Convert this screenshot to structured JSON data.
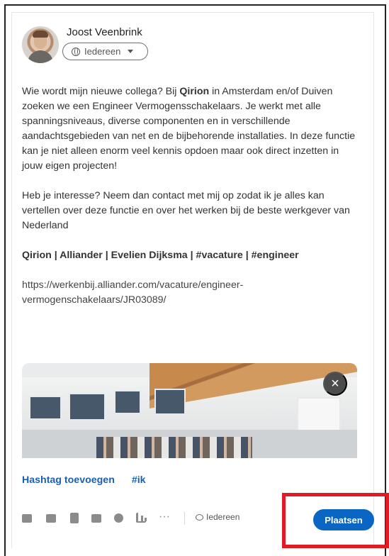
{
  "author": {
    "name": "Joost Veenbrink",
    "visibility_label": "Iedereen"
  },
  "post": {
    "paragraph1_start": "Wie wordt mijn nieuwe collega? Bij ",
    "paragraph1_company": "Qirion",
    "paragraph1_end": " in Amsterdam en/of Duiven zoeken we een Engineer Vermogensschakelaars. Je werkt met alle spanningsniveaus, diverse componenten en in verschillende aandachtsgebieden van net en de bijbehorende installaties. In deze functie kan je niet alleen enorm veel kennis opdoen maar ook direct inzetten in jouw eigen projecten!",
    "paragraph2": "Heb je interesse? Neem dan contact met mij op zodat ik je alles kan vertellen over deze functie en over het werken bij de beste werkgever van Nederland",
    "tags_line": "Qirion | Alliander | Evelien Dijksma | #vacature | #engineer",
    "url": "https://werkenbij.alliander.com/vacature/engineer-vermogenschakelaars/JR03089/"
  },
  "image": {
    "close_icon": "×"
  },
  "hashtags": {
    "add_label": "Hashtag toevoegen",
    "suggested": "#ik"
  },
  "toolbar": {
    "more_label": "···",
    "comment_visibility": "Iedereen",
    "post_button": "Plaatsen"
  },
  "colors": {
    "accent": "#0a66c2",
    "highlight": "#e01b24"
  }
}
